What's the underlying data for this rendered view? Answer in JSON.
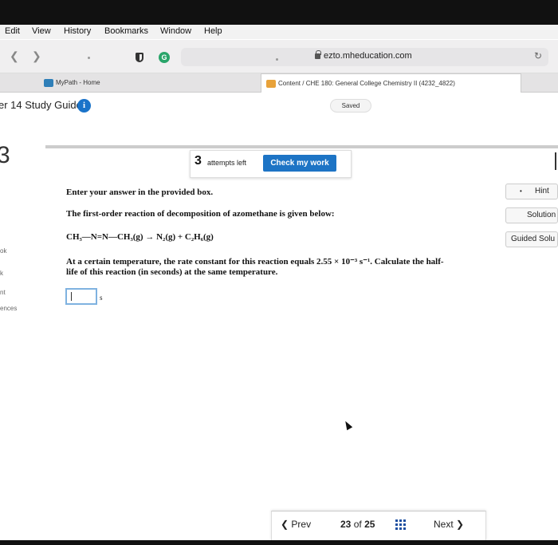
{
  "menu": [
    "Edit",
    "View",
    "History",
    "Bookmarks",
    "Window",
    "Help"
  ],
  "browser": {
    "url": "ezto.mheducation.com"
  },
  "tabs": [
    {
      "label": "MyPath - Home"
    },
    {
      "label": "Content / CHE 180: General College Chemistry II (4232_4822)"
    }
  ],
  "header": {
    "title": "er 14 Study Guide",
    "info": "i",
    "saved": "Saved"
  },
  "question": {
    "number": "3",
    "attempts_num": "3",
    "attempts_label": "attempts left",
    "check_label": "Check my work",
    "instruction": "Enter your answer in the provided box.",
    "prompt": "The first-order reaction of decomposition of azomethane is given below:",
    "equation": "CH₃—N=N—CH₃(g) → N₂(g) + C₂H₆(g)",
    "body_line1": "At a certain temperature, the rate constant for this reaction equals 2.55 × 10⁻³ s⁻¹. Calculate the half-",
    "body_line2": "life of this reaction (in seconds) at the same temperature.",
    "answer_value": "",
    "unit": "s"
  },
  "side": {
    "hint": "Hint",
    "solution": "Solution",
    "guided": "Guided Solu"
  },
  "left_fragments": [
    "ok",
    "k",
    "nt",
    "ences"
  ],
  "pagination": {
    "prev": "Prev",
    "current": "23",
    "of": "of",
    "total": "25",
    "next": "Next"
  }
}
